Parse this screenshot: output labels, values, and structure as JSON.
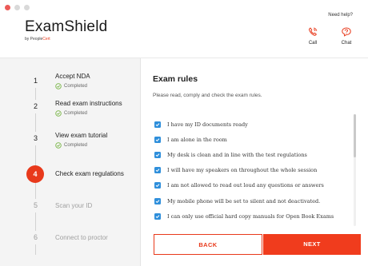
{
  "app": {
    "title": "ExamShield",
    "byline_prefix": "by People",
    "byline_brand": "Cert"
  },
  "help": {
    "title": "Need help?",
    "call_label": "Call",
    "chat_label": "Chat"
  },
  "steps": [
    {
      "number": "1",
      "title": "Accept NDA",
      "status": "Completed"
    },
    {
      "number": "2",
      "title": "Read exam instructions",
      "status": "Completed"
    },
    {
      "number": "3",
      "title": "View exam tutorial",
      "status": "Completed"
    },
    {
      "number": "4",
      "title": "Check exam regulations"
    },
    {
      "number": "5",
      "title": "Scan your ID"
    },
    {
      "number": "6",
      "title": "Connect to proctor"
    }
  ],
  "main": {
    "title": "Exam rules",
    "subtitle": "Please read, comply and check the exam rules.",
    "rules": [
      "I have my ID documents ready",
      "I am alone in the room",
      "My desk is clean and in line with the test regulations",
      "I will have my speakers on throughout the whole session",
      "I am not allowed to read out loud any questions or answers",
      "My mobile phone will be set to silent and not deactivated.",
      "I can only use official hard copy manuals for Open Book Exams"
    ],
    "back_label": "BACK",
    "next_label": "NEXT"
  },
  "colors": {
    "accent": "#e8391b",
    "checkbox": "#2f8fdb",
    "completed": "#7ab648"
  }
}
